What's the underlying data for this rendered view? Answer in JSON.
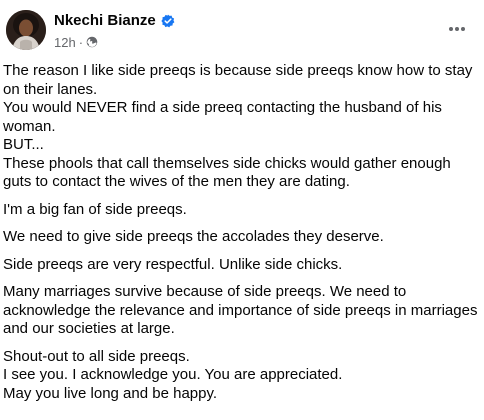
{
  "author": {
    "name": "Nkechi Bianze",
    "verified": true,
    "timestamp": "12h",
    "separator": "·",
    "audience_icon": "globe-icon",
    "avatar_icon": "avatar"
  },
  "more_icon": "more-horizontal-icon",
  "colors": {
    "text": "#050505",
    "secondary": "#65676b",
    "verified": "#1877f2"
  },
  "paragraphs": [
    {
      "lines": [
        "The reason I like side preeqs is because side preeqs know how to stay on their lanes.",
        "You would NEVER find a side preeq contacting the husband of his woman.",
        "BUT...",
        "These phools that call themselves side chicks would gather enough guts to contact the wives of the men they are dating."
      ]
    },
    {
      "lines": [
        "I'm a big fan of side preeqs."
      ]
    },
    {
      "lines": [
        "We need to give side preeqs the accolades they deserve."
      ]
    },
    {
      "lines": [
        "Side preeqs are very respectful. Unlike side chicks."
      ]
    },
    {
      "lines": [
        "Many marriages survive because of side preeqs. We need to acknowledge the relevance and importance of side preeqs in marriages and our societies at large."
      ]
    },
    {
      "lines": [
        "Shout-out to all side preeqs.",
        "I see you. I acknowledge you. You are appreciated.",
        "May you live long and be happy."
      ]
    }
  ]
}
